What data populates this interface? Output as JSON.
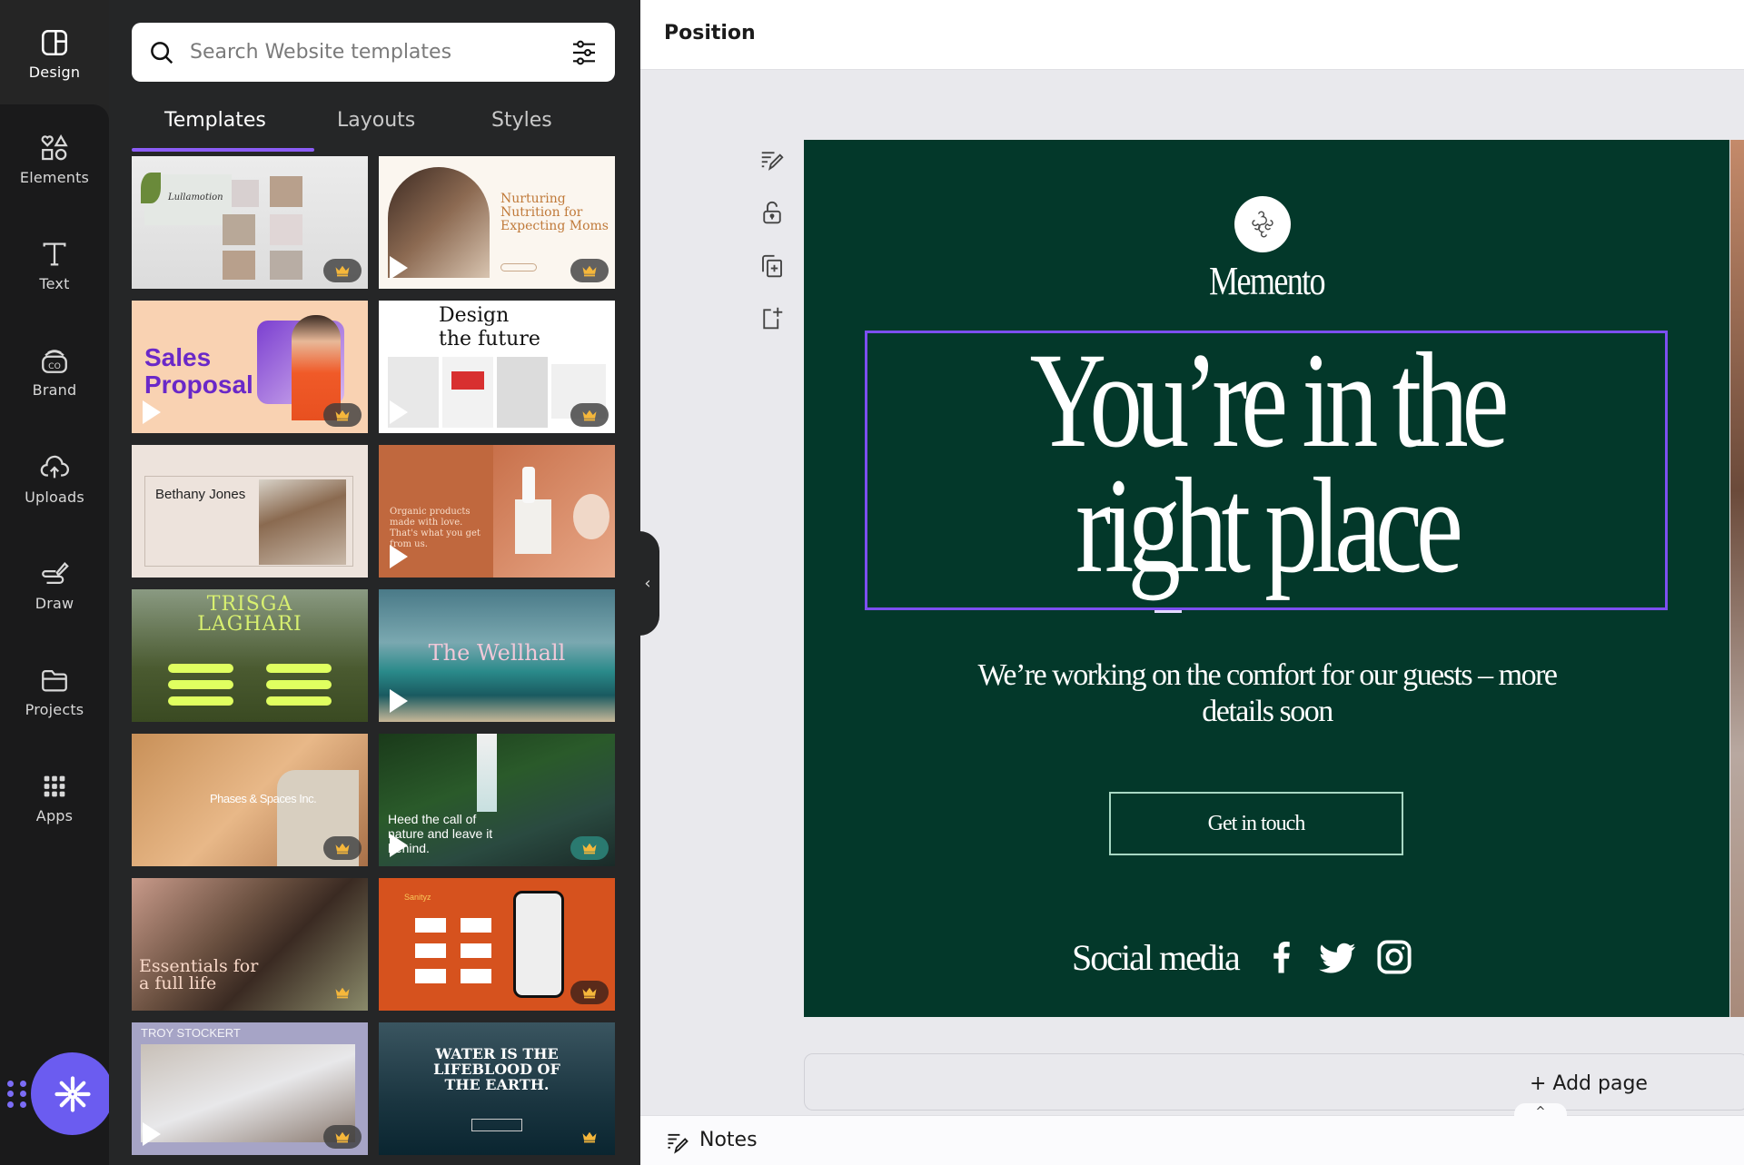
{
  "rail": {
    "items": [
      {
        "label": "Design",
        "icon": "design-icon"
      },
      {
        "label": "Elements",
        "icon": "elements-icon"
      },
      {
        "label": "Text",
        "icon": "text-icon"
      },
      {
        "label": "Brand",
        "icon": "brand-icon"
      },
      {
        "label": "Uploads",
        "icon": "uploads-icon"
      },
      {
        "label": "Draw",
        "icon": "draw-icon"
      },
      {
        "label": "Projects",
        "icon": "projects-icon"
      },
      {
        "label": "Apps",
        "icon": "apps-icon"
      }
    ],
    "magic_button_icon": "sparkle-icon"
  },
  "panel": {
    "search": {
      "placeholder": "Search Website templates",
      "value": ""
    },
    "tabs": [
      {
        "label": "Templates",
        "active": true
      },
      {
        "label": "Layouts",
        "active": false
      },
      {
        "label": "Styles",
        "active": false
      }
    ],
    "templates": [
      {
        "title": "Lullamotion",
        "premium": true,
        "video": false
      },
      {
        "title": "Nurturing Nutrition for Expecting Moms",
        "premium": true,
        "video": true
      },
      {
        "title": "Sales Proposal",
        "premium": true,
        "video": true
      },
      {
        "title": "Design the future",
        "premium": true,
        "video": true
      },
      {
        "title": "Bethany Jones",
        "premium": false,
        "video": false
      },
      {
        "title": "Organic products made with love. That's what you get from us.",
        "premium": false,
        "video": true
      },
      {
        "title": "TRISGA LAGHARI",
        "premium": false,
        "video": false
      },
      {
        "title": "The Wellhall",
        "premium": false,
        "video": true
      },
      {
        "title": "Phases & Spaces Inc.",
        "premium": true,
        "video": false
      },
      {
        "title": "Heed the call of nature and leave it behind.",
        "premium": true,
        "video": true
      },
      {
        "title": "Essentials for a full life",
        "premium": true,
        "video": false
      },
      {
        "title": "Sanityz",
        "premium": true,
        "video": false
      },
      {
        "title": "TROY STOCKERT",
        "premium": true,
        "video": true
      },
      {
        "title": "WATER IS THE LIFEBLOOD OF THE EARTH.",
        "premium": true,
        "video": false
      }
    ]
  },
  "header": {
    "title": "Position"
  },
  "tools": [
    "notes-edit-icon",
    "unlock-icon",
    "duplicate-page-icon",
    "add-page-icon"
  ],
  "canvas": {
    "brand": "Memento",
    "headline": "You’re in the right place",
    "subtitle": "We’re working on the comfort for our guests – more details soon",
    "cta": "Get in touch",
    "social_label": "Social media",
    "social_icons": [
      "facebook-icon",
      "twitter-icon",
      "instagram-icon"
    ],
    "bg_color": "#03382a",
    "selection_color": "#7c4ff0"
  },
  "footer": {
    "add_page": "+ Add page",
    "notes": "Notes",
    "expand_caret": "^"
  }
}
